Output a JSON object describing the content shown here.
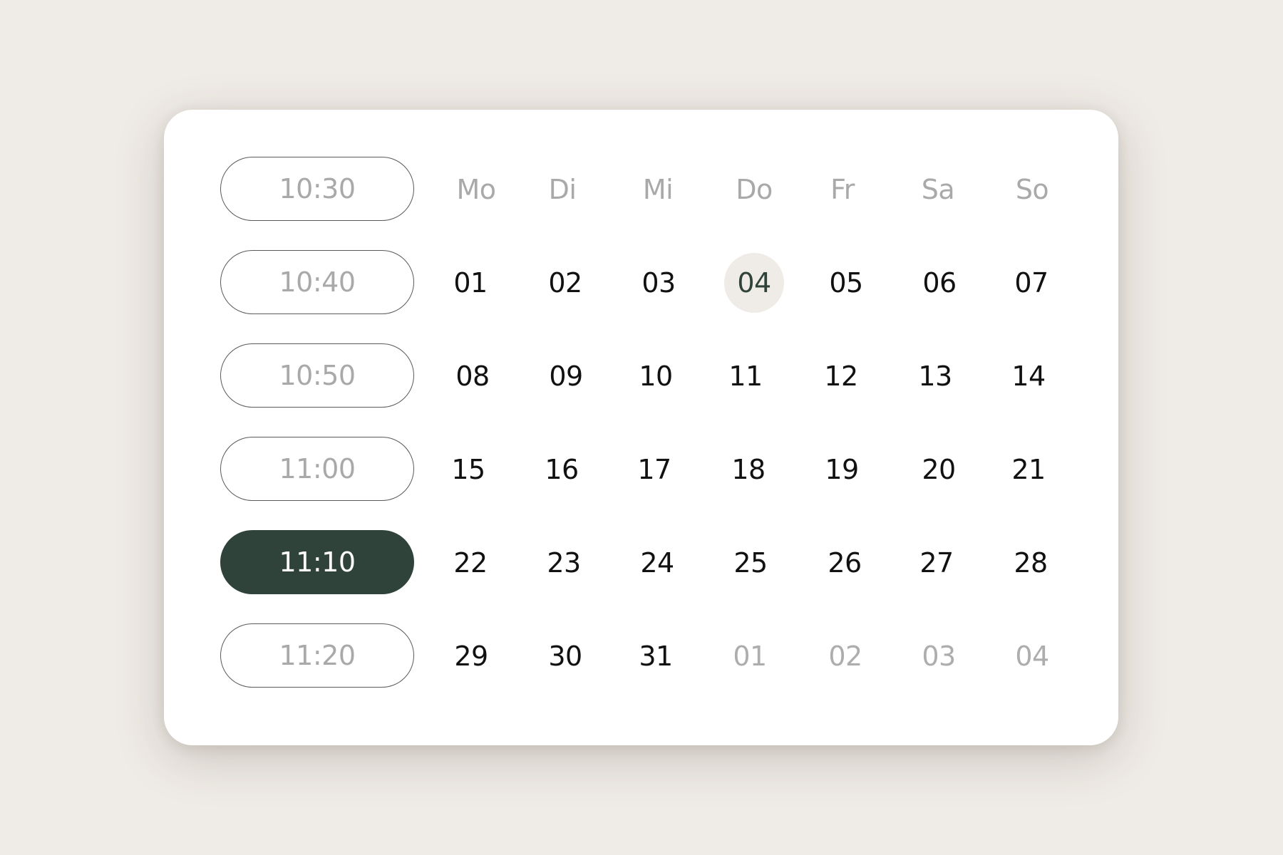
{
  "time_slots": [
    {
      "label": "10:30",
      "selected": false
    },
    {
      "label": "10:40",
      "selected": false
    },
    {
      "label": "10:50",
      "selected": false
    },
    {
      "label": "11:00",
      "selected": false
    },
    {
      "label": "11:10",
      "selected": true
    },
    {
      "label": "11:20",
      "selected": false
    }
  ],
  "calendar": {
    "weekdays": [
      "Mo",
      "Di",
      "Mi",
      "Do",
      "Fr",
      "Sa",
      "So"
    ],
    "weeks": [
      [
        {
          "label": "01",
          "state": "normal"
        },
        {
          "label": "02",
          "state": "normal"
        },
        {
          "label": "03",
          "state": "normal"
        },
        {
          "label": "04",
          "state": "today"
        },
        {
          "label": "05",
          "state": "normal"
        },
        {
          "label": "06",
          "state": "normal"
        },
        {
          "label": "07",
          "state": "normal"
        }
      ],
      [
        {
          "label": "08",
          "state": "normal"
        },
        {
          "label": "09",
          "state": "normal"
        },
        {
          "label": "10",
          "state": "normal"
        },
        {
          "label": "11",
          "state": "normal"
        },
        {
          "label": "12",
          "state": "normal"
        },
        {
          "label": "13",
          "state": "normal"
        },
        {
          "label": "14",
          "state": "normal"
        }
      ],
      [
        {
          "label": "15",
          "state": "normal"
        },
        {
          "label": "16",
          "state": "normal"
        },
        {
          "label": "17",
          "state": "normal"
        },
        {
          "label": "18",
          "state": "normal"
        },
        {
          "label": "19",
          "state": "normal"
        },
        {
          "label": "20",
          "state": "normal"
        },
        {
          "label": "21",
          "state": "normal"
        }
      ],
      [
        {
          "label": "22",
          "state": "normal"
        },
        {
          "label": "23",
          "state": "normal"
        },
        {
          "label": "24",
          "state": "normal"
        },
        {
          "label": "25",
          "state": "normal"
        },
        {
          "label": "26",
          "state": "normal"
        },
        {
          "label": "27",
          "state": "normal"
        },
        {
          "label": "28",
          "state": "normal"
        }
      ],
      [
        {
          "label": "29",
          "state": "normal"
        },
        {
          "label": "30",
          "state": "normal"
        },
        {
          "label": "31",
          "state": "normal"
        },
        {
          "label": "01",
          "state": "muted"
        },
        {
          "label": "02",
          "state": "muted"
        },
        {
          "label": "03",
          "state": "muted"
        },
        {
          "label": "04",
          "state": "muted"
        }
      ]
    ]
  },
  "colors": {
    "page_background": "#efebe6",
    "card_background": "#ffffff",
    "accent": "#2f433b",
    "today_highlight": "#efebe6",
    "muted_text": "#a9a9a9",
    "primary_text": "#111111"
  }
}
